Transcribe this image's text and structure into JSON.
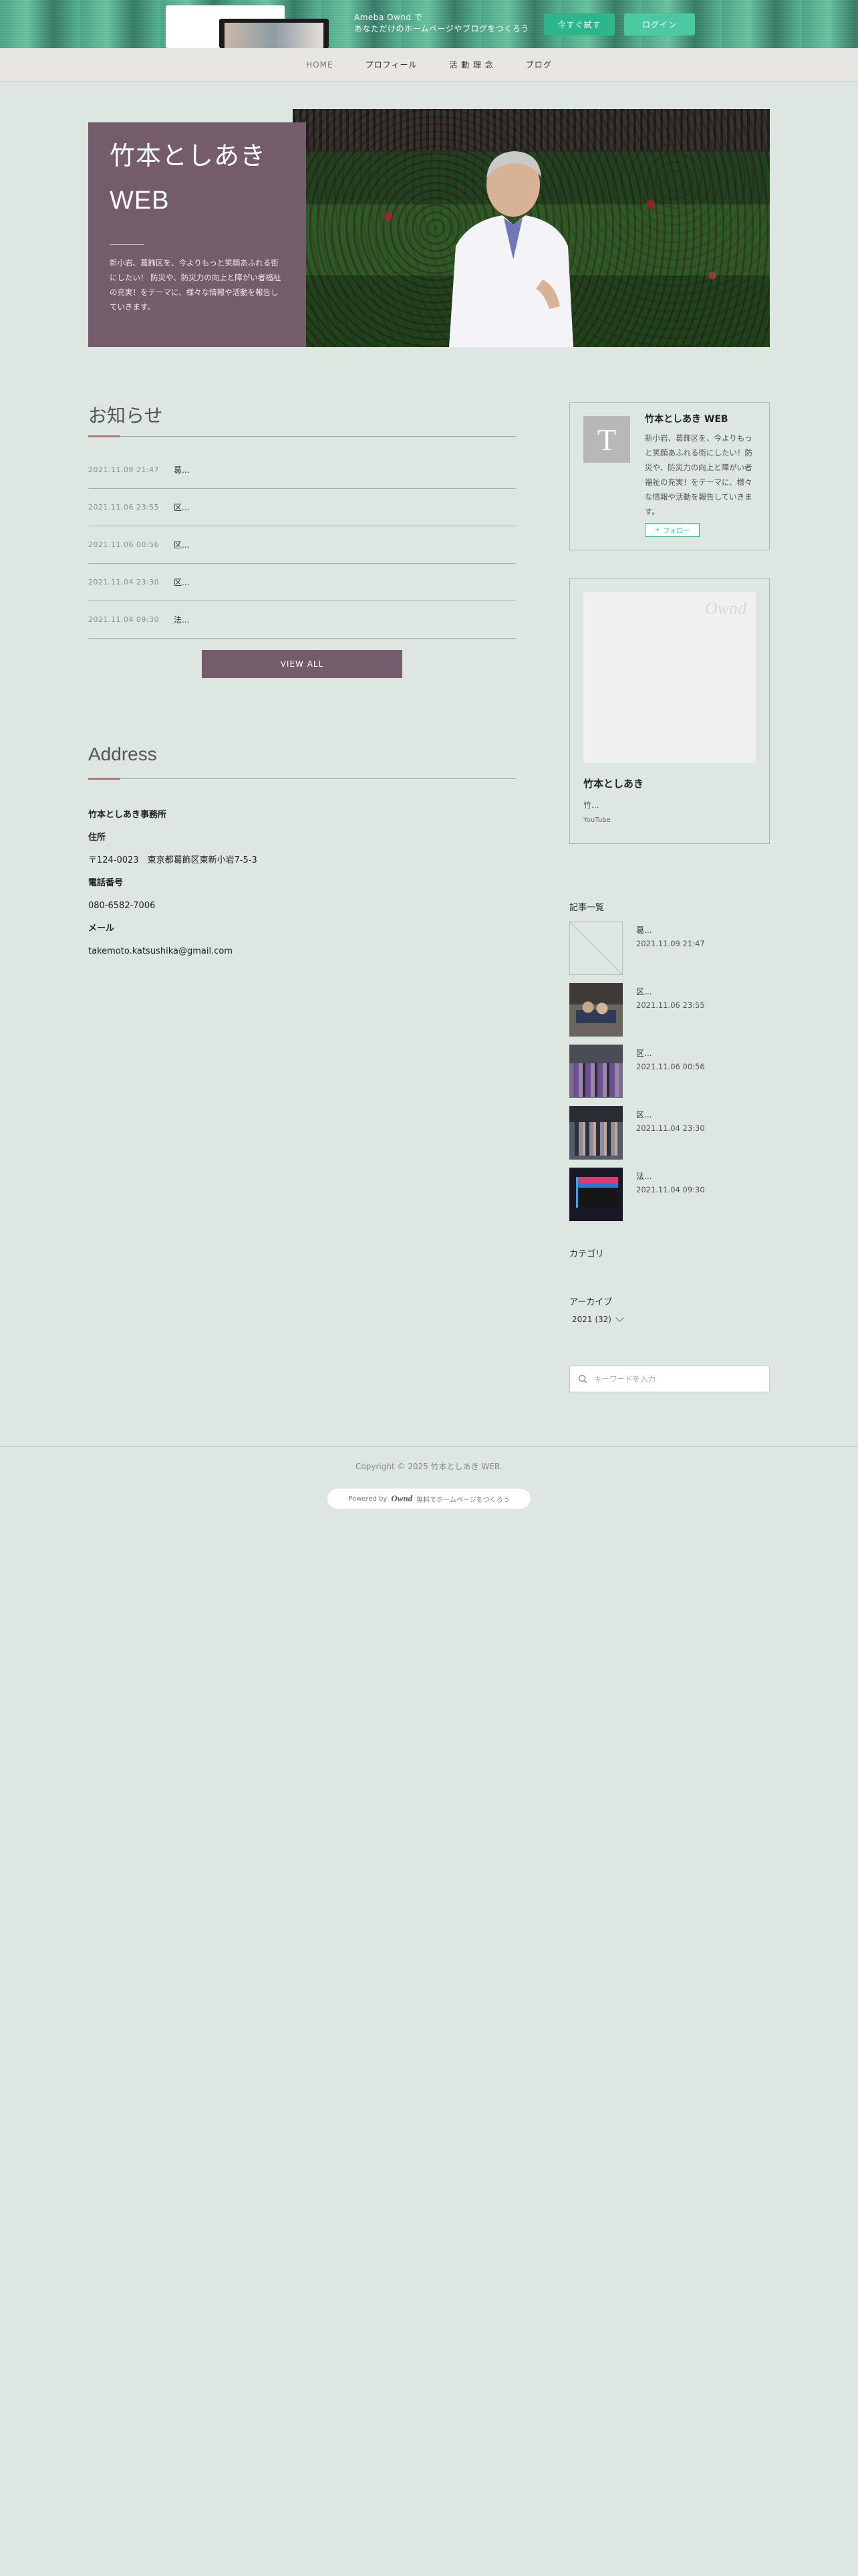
{
  "promo": {
    "line1": "Ameba Ownd で",
    "line2": "あなただけのホームページやブログをつくろう",
    "try_label": "今すぐ試す",
    "login_label": "ログイン"
  },
  "nav": {
    "items": [
      {
        "label": "HOME"
      },
      {
        "label": "プロフィール"
      },
      {
        "label": "活 動 理 念"
      },
      {
        "label": "ブログ"
      }
    ]
  },
  "hero": {
    "title": "竹本としあき WEB",
    "description": "新小岩、葛飾区を、今よりもっと笑顔あふれる街にしたい！ 防災や、防災力の向上と障がい者福祉の充実！をテーマに、様々な情報や活動を報告していきます。"
  },
  "news": {
    "title": "お知らせ",
    "items": [
      {
        "date": "2021.11.09 21:47",
        "text": "葛..."
      },
      {
        "date": "2021.11.06 23:55",
        "text": "区..."
      },
      {
        "date": "2021.11.06 00:56",
        "text": "区..."
      },
      {
        "date": "2021.11.04 23:30",
        "text": "区..."
      },
      {
        "date": "2021.11.04 09:30",
        "text": "法..."
      }
    ],
    "view_all": "VIEW ALL"
  },
  "address": {
    "title": "Address",
    "office": "竹本としあき事務所",
    "addr_label": "住所",
    "addr_value": "〒124-0023　東京都葛飾区東新小岩7-5-3",
    "phone_label": "電話番号",
    "phone_value": "080-6582-7006",
    "mail_label": "メール",
    "mail_value": "takemoto.katsushika@gmail.com"
  },
  "profile": {
    "avatar_letter": "T",
    "name": "竹本としあき WEB",
    "description": "新小岩、葛飾区を、今よりもっと笑顔あふれる街にしたい！防災や、防災力の向上と障がい者福祉の充実！をテーマに、様々な情報や活動を報告していきます。",
    "follow_label": "フォロー"
  },
  "owned": {
    "logo": "Ownd",
    "name": "竹本としあき",
    "desc": "竹...",
    "link": "YouTube"
  },
  "recent": {
    "title": "記事一覧",
    "items": [
      {
        "title": "葛...",
        "date": "2021.11.09 21:47"
      },
      {
        "title": "区...",
        "date": "2021.11.06 23:55"
      },
      {
        "title": "区...",
        "date": "2021.11.06 00:56"
      },
      {
        "title": "区...",
        "date": "2021.11.04 23:30"
      },
      {
        "title": "法...",
        "date": "2021.11.04 09:30"
      }
    ]
  },
  "category": {
    "title": "カテゴリ"
  },
  "archive": {
    "title": "アーカイブ",
    "selected": "2021 (32)"
  },
  "search": {
    "placeholder": "キーワードを入力"
  },
  "footer": {
    "copyright": "Copyright © 2025 竹本としあき WEB.",
    "powered_prefix": "Powered by",
    "powered_brand": "Ownd",
    "powered_suffix": "無料でホームページをつくろう"
  },
  "colors": {
    "background": "#dde6e0",
    "accent_mauve": "#745c6a",
    "accent_green": "#39b58b",
    "underline_pink": "#c2707a"
  }
}
